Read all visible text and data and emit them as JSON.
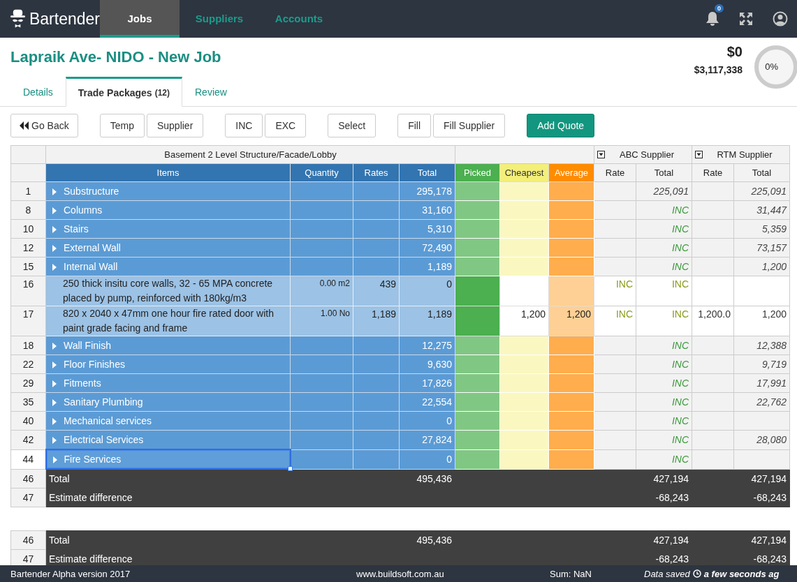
{
  "navbar": {
    "brand": "Bartender",
    "tabs": [
      {
        "label": "Jobs",
        "selected": true
      },
      {
        "label": "Suppliers",
        "selected": false
      },
      {
        "label": "Accounts",
        "selected": false
      }
    ],
    "notification_count": "0"
  },
  "job": {
    "title": "Lapraik Ave- NIDO - New Job",
    "amount": "$0",
    "budget": "$3,117,338",
    "progress": {
      "reading": "0%"
    }
  },
  "tabs": [
    {
      "label": "Details",
      "selected": false
    },
    {
      "label": "Trade Packages",
      "count": "(12)",
      "selected": true
    },
    {
      "label": "Review",
      "selected": false
    }
  ],
  "toolbar": [
    [
      {
        "label": "Go Back",
        "kind": "back"
      }
    ],
    [
      {
        "label": "Temp",
        "kind": "default"
      },
      {
        "label": "Supplier",
        "kind": "default"
      }
    ],
    [
      {
        "label": "INC",
        "kind": "default"
      },
      {
        "label": "EXC",
        "kind": "default"
      }
    ],
    [
      {
        "label": "Select",
        "kind": "default"
      }
    ],
    [
      {
        "label": "Fill",
        "kind": "default"
      },
      {
        "label": "Fill Supplier",
        "kind": "default"
      }
    ],
    [
      {
        "label": "Add Quote",
        "kind": "primary"
      }
    ]
  ],
  "table": {
    "section": "Basement 2 Level Structure/Facade/Lobby",
    "columns": [
      "Items",
      "Quantity",
      "Rates",
      "Total"
    ],
    "compare_columns": [
      {
        "label": "Picked",
        "color": "#4caf50"
      },
      {
        "label": "Cheapest",
        "color": "#f3ef79"
      },
      {
        "label": "Average",
        "color": "#ff8c00"
      }
    ],
    "suppliers": [
      {
        "name": "ABC Supplier",
        "columns": [
          "Rate",
          "Total"
        ]
      },
      {
        "name": "RTM Supplier",
        "columns": [
          "Rate",
          "Total"
        ]
      }
    ],
    "rows": [
      {
        "num": "1",
        "kind": "group",
        "item": "Substructure",
        "total": "295,178",
        "suppliers": [
          {
            "total": {
              "text": "225,091",
              "included": false
            }
          },
          {
            "total": {
              "text": "225,091",
              "included": false
            }
          }
        ],
        "selected": false
      },
      {
        "num": "8",
        "kind": "group",
        "item": "Columns",
        "total": "31,160",
        "suppliers": [
          {
            "total": {
              "text": "INC",
              "included": true
            }
          },
          {
            "total": {
              "text": "31,447",
              "included": false
            }
          }
        ],
        "selected": false
      },
      {
        "num": "10",
        "kind": "group",
        "item": "Stairs",
        "total": "5,310",
        "suppliers": [
          {
            "total": {
              "text": "INC",
              "included": true
            }
          },
          {
            "total": {
              "text": "5,359",
              "included": false
            }
          }
        ],
        "selected": false
      },
      {
        "num": "12",
        "kind": "group",
        "item": "External Wall",
        "total": "72,490",
        "suppliers": [
          {
            "total": {
              "text": "INC",
              "included": true
            }
          },
          {
            "total": {
              "text": "73,157",
              "included": false
            }
          }
        ],
        "selected": false
      },
      {
        "num": "15",
        "kind": "group",
        "item": "Internal Wall",
        "total": "1,189",
        "suppliers": [
          {
            "total": {
              "text": "INC",
              "included": true
            }
          },
          {
            "total": {
              "text": "1,200",
              "included": false
            }
          }
        ],
        "selected": false
      },
      {
        "num": "16",
        "kind": "item",
        "item": "250 thick insitu core walls, 32 - 65 MPA concrete placed by pump, reinforced with 180kg/m3",
        "quantity": "0.00 m2",
        "rates": "439",
        "total": "0",
        "suppliers": [
          {
            "rate": {
              "text": "INC",
              "included": true
            },
            "total": {
              "text": "INC",
              "included": true
            }
          }
        ],
        "selected": false
      },
      {
        "num": "17",
        "kind": "item",
        "item": "820 x 2040 x 47mm one hour fire rated door with paint grade facing and frame",
        "quantity": "1.00 No",
        "rates": "1,189",
        "total": "1,189",
        "cheapest": "1,200",
        "average": "1,200",
        "suppliers": [
          {
            "rate": {
              "text": "INC",
              "included": true
            },
            "total": {
              "text": "INC",
              "included": true
            }
          },
          {
            "rate": {
              "text": "1,200.0",
              "included": false
            },
            "total": {
              "text": "1,200",
              "included": false
            }
          }
        ],
        "selected": false
      },
      {
        "num": "18",
        "kind": "group",
        "item": "Wall Finish",
        "total": "12,275",
        "suppliers": [
          {
            "total": {
              "text": "INC",
              "included": true
            }
          },
          {
            "total": {
              "text": "12,388",
              "included": false
            }
          }
        ],
        "selected": false
      },
      {
        "num": "22",
        "kind": "group",
        "item": "Floor Finishes",
        "total": "9,630",
        "suppliers": [
          {
            "total": {
              "text": "INC",
              "included": true
            }
          },
          {
            "total": {
              "text": "9,719",
              "included": false
            }
          }
        ],
        "selected": false
      },
      {
        "num": "29",
        "kind": "group",
        "item": "Fitments",
        "total": "17,826",
        "suppliers": [
          {
            "total": {
              "text": "INC",
              "included": true
            }
          },
          {
            "total": {
              "text": "17,991",
              "included": false
            }
          }
        ],
        "selected": false
      },
      {
        "num": "35",
        "kind": "group",
        "item": "Sanitary Plumbing",
        "total": "22,554",
        "suppliers": [
          {
            "total": {
              "text": "INC",
              "included": true
            }
          },
          {
            "total": {
              "text": "22,762",
              "included": false
            }
          }
        ],
        "selected": false
      },
      {
        "num": "40",
        "kind": "group",
        "item": "Mechanical services",
        "total": "0",
        "suppliers": [
          {
            "total": {
              "text": "INC",
              "included": true
            }
          }
        ],
        "selected": false
      },
      {
        "num": "42",
        "kind": "group",
        "item": "Electrical Services",
        "total": "27,824",
        "suppliers": [
          {
            "total": {
              "text": "INC",
              "included": true
            }
          },
          {
            "total": {
              "text": "28,080",
              "included": false
            }
          }
        ],
        "selected": false
      },
      {
        "num": "44",
        "kind": "group",
        "item": "Fire Services",
        "total": "0",
        "suppliers": [
          {
            "total": {
              "text": "INC",
              "included": true
            }
          }
        ],
        "selected": true
      }
    ],
    "summary": [
      {
        "num": "46",
        "label": "Total",
        "total": "495,436",
        "supplier_totals": [
          "427,194",
          "427,194"
        ]
      },
      {
        "num": "47",
        "label": "Estimate difference",
        "supplier_totals": [
          "-68,243",
          "-68,243"
        ]
      }
    ]
  },
  "summary": [
    {
      "num": "46",
      "label": "Total",
      "total": "495,436",
      "supplier_totals": [
        "427,194",
        "427,194"
      ]
    },
    {
      "num": "47",
      "label": "Estimate difference",
      "supplier_totals": [
        "-68,243",
        "-68,243"
      ]
    }
  ],
  "footer": {
    "version": "Bartender Alpha version 2017",
    "website": "www.buildsoft.com.au",
    "sum": "Sum: NaN",
    "saved_label": "Data saved",
    "saved_time": "a few seconds ag"
  }
}
